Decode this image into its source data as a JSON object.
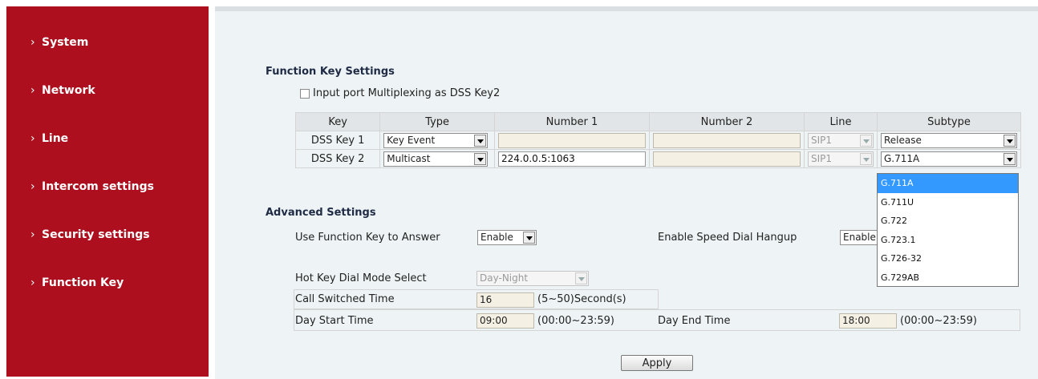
{
  "sidebar": {
    "items": [
      {
        "label": "System"
      },
      {
        "label": "Network"
      },
      {
        "label": "Line"
      },
      {
        "label": "Intercom settings"
      },
      {
        "label": "Security settings"
      },
      {
        "label": "Function Key"
      }
    ]
  },
  "function_key": {
    "title": "Function Key Settings",
    "multiplex_label": "Input port Multiplexing as DSS Key2",
    "headers": [
      "Key",
      "Type",
      "Number 1",
      "Number 2",
      "Line",
      "Subtype"
    ],
    "rows": [
      {
        "key": "DSS Key 1",
        "type": "Key Event",
        "number1": "",
        "number2": "",
        "line": "SIP1",
        "subtype": "Release"
      },
      {
        "key": "DSS Key 2",
        "type": "Multicast",
        "number1": "224.0.0.5:1063",
        "number2": "",
        "line": "SIP1",
        "subtype": "G.711A"
      }
    ],
    "subtype_options": [
      "G.711A",
      "G.711U",
      "G.722",
      "G.723.1",
      "G.726-32",
      "G.729AB"
    ],
    "subtype_selected": "G.711A"
  },
  "advanced": {
    "title": "Advanced Settings",
    "use_fk_answer_label": "Use Function Key to Answer",
    "use_fk_answer_value": "Enable",
    "speed_dial_hangup_label": "Enable Speed Dial Hangup",
    "speed_dial_hangup_value": "Enable",
    "hotkey_mode_label": "Hot Key Dial Mode Select",
    "hotkey_mode_value": "Day-Night",
    "call_switched_label": "Call Switched Time",
    "call_switched_value": "16",
    "call_switched_range": "(5~50)Second(s)",
    "day_start_label": "Day Start Time",
    "day_start_value": "09:00",
    "day_start_range": "(00:00~23:59)",
    "day_end_label": "Day End Time",
    "day_end_value": "18:00",
    "day_end_range": "(00:00~23:59)"
  },
  "apply_label": "Apply",
  "colors": {
    "sidebar": "#ad0f1e",
    "main_bg": "#eef4f6",
    "selected_option": "#3399ff"
  }
}
